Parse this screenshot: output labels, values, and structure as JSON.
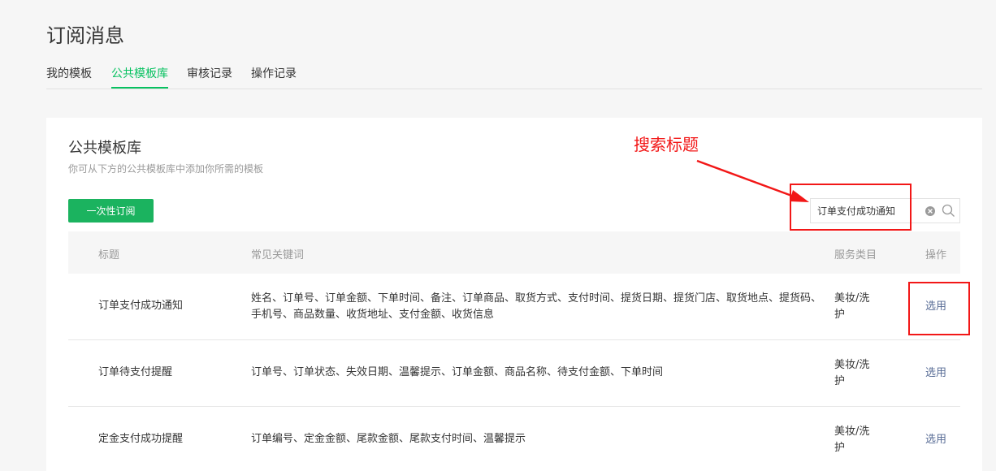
{
  "page": {
    "title": "订阅消息"
  },
  "tabs": [
    {
      "label": "我的模板",
      "active": false
    },
    {
      "label": "公共模板库",
      "active": true
    },
    {
      "label": "审核记录",
      "active": false
    },
    {
      "label": "操作记录",
      "active": false
    }
  ],
  "card": {
    "title": "公共模板库",
    "subtitle": "你可从下方的公共模板库中添加你所需的模板",
    "one_time_button": "一次性订阅"
  },
  "search": {
    "value": "订单支付成功通知"
  },
  "table": {
    "headers": {
      "title": "标题",
      "keywords": "常见关键词",
      "category": "服务类目",
      "action": "操作"
    },
    "rows": [
      {
        "title": "订单支付成功通知",
        "keywords": "姓名、订单号、订单金额、下单时间、备注、订单商品、取货方式、支付时间、提货日期、提货门店、取货地点、提货码、手机号、商品数量、收货地址、支付金额、收货信息",
        "category": "美妆/洗护",
        "action": "选用"
      },
      {
        "title": "订单待支付提醒",
        "keywords": "订单号、订单状态、失效日期、温馨提示、订单金额、商品名称、待支付金额、下单时间",
        "category": "美妆/洗护",
        "action": "选用"
      },
      {
        "title": "定金支付成功提醒",
        "keywords": "订单编号、定金金额、尾款金额、尾款支付时间、温馨提示",
        "category": "美妆/洗护",
        "action": "选用"
      }
    ]
  },
  "annotation": {
    "label": "搜索标题",
    "color": "#f21717"
  },
  "colors": {
    "accent": "#07c160",
    "link": "#576b95",
    "button": "#1bb35f"
  }
}
